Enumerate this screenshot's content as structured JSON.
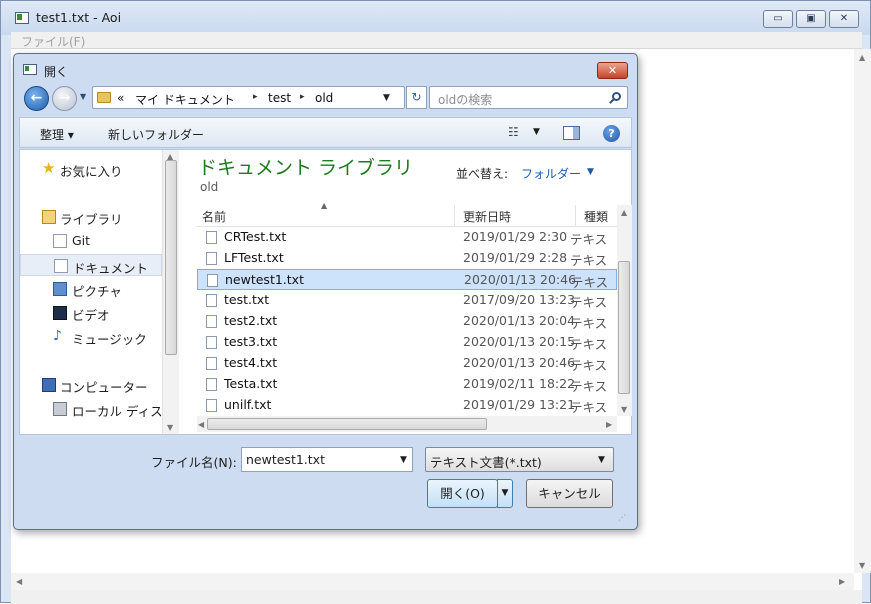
{
  "app": {
    "title": "test1.txt - Aoi",
    "min": "▭",
    "max": "▣",
    "close": "✕",
    "menu_file": "ファイル(F)"
  },
  "dialog": {
    "title": "開く",
    "close": "✕",
    "back_glyph": "←",
    "fwd_glyph": "→",
    "breadcrumb": {
      "overflow": "«",
      "items": [
        "マイ ドキュメント",
        "test",
        "old"
      ]
    },
    "refresh_glyph": "↻",
    "search_placeholder": "oldの検索",
    "toolbar": {
      "organize": "整理 ▾",
      "new_folder": "新しいフォルダー",
      "views_glyph": "☷"
    },
    "help": "?",
    "nav": {
      "favorites": "お気に入り",
      "libraries": "ライブラリ",
      "git": "Git",
      "documents": "ドキュメント",
      "pictures": "ピクチャ",
      "videos": "ビデオ",
      "music": "ミュージック",
      "computer": "コンピューター",
      "local_disk": "ローカル ディス"
    },
    "library": {
      "title": "ドキュメント ライブラリ",
      "subtitle": "old",
      "arrange_label": "並べ替え:",
      "arrange_value": "フォルダー"
    },
    "columns": {
      "name": "名前",
      "modified": "更新日時",
      "type": "種類"
    },
    "files": [
      {
        "name": "CRTest.txt",
        "date": "2019/01/29 2:30",
        "type": "テキス"
      },
      {
        "name": "LFTest.txt",
        "date": "2019/01/29 2:28",
        "type": "テキス"
      },
      {
        "name": "newtest1.txt",
        "date": "2020/01/13 20:46",
        "type": "テキス"
      },
      {
        "name": "test.txt",
        "date": "2017/09/20 13:23",
        "type": "テキス"
      },
      {
        "name": "test2.txt",
        "date": "2020/01/13 20:04",
        "type": "テキス"
      },
      {
        "name": "test3.txt",
        "date": "2020/01/13 20:15",
        "type": "テキス"
      },
      {
        "name": "test4.txt",
        "date": "2020/01/13 20:46",
        "type": "テキス"
      },
      {
        "name": "Testa.txt",
        "date": "2019/02/11 18:22",
        "type": "テキス"
      },
      {
        "name": "unilf.txt",
        "date": "2019/01/29 13:21",
        "type": "テキス"
      }
    ],
    "filename_label": "ファイル名(N):",
    "filename_value": "newtest1.txt",
    "filetype_value": "テキスト文書(*.txt)",
    "open_label": "開く(O)",
    "cancel_label": "キャンセル"
  },
  "colors": {
    "library_title": "#1e7a1e",
    "link": "#1d5aa8",
    "selection": "#cde2fb"
  }
}
